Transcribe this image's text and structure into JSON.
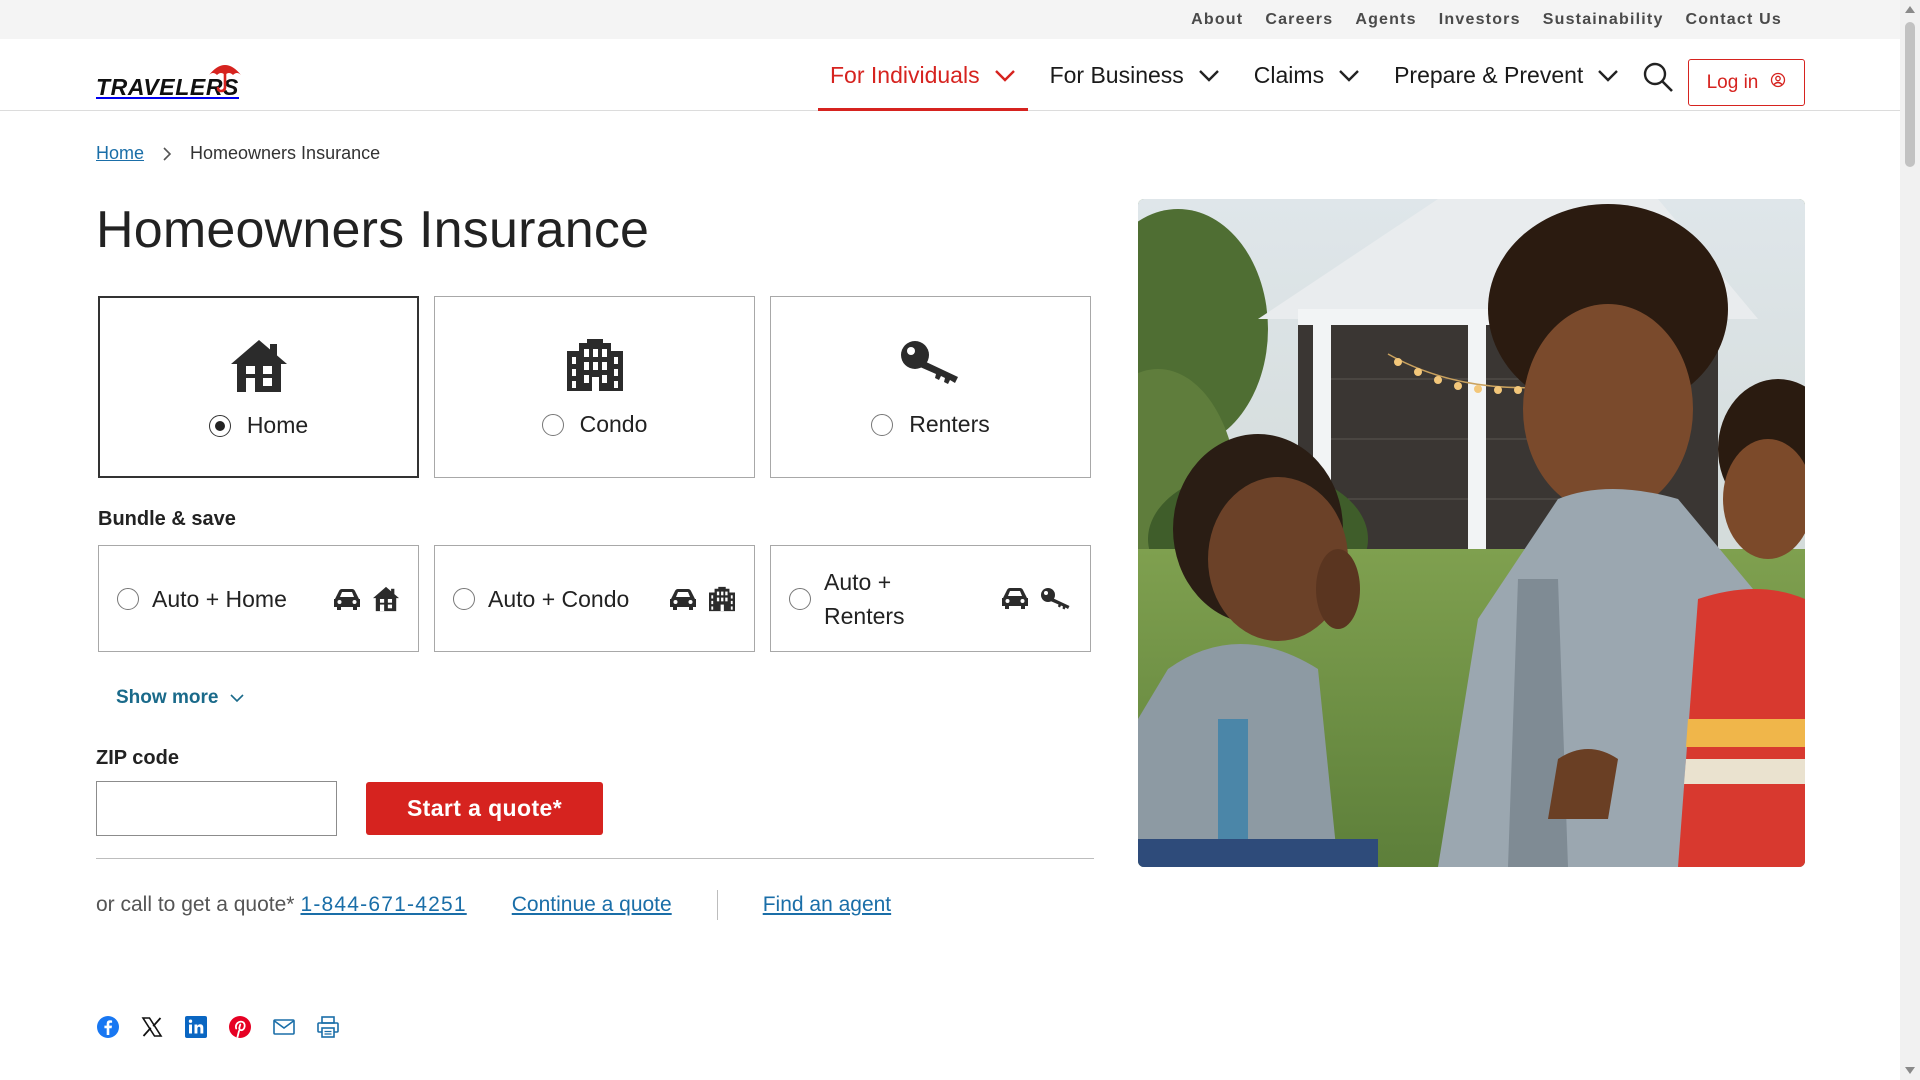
{
  "utility_nav": [
    "About",
    "Careers",
    "Agents",
    "Investors",
    "Sustainability",
    "Contact Us"
  ],
  "brand": {
    "name": "TRAVELERS",
    "color": "#d6231f"
  },
  "main_nav": {
    "items": [
      {
        "label": "For Individuals",
        "active": true
      },
      {
        "label": "For Business",
        "active": false
      },
      {
        "label": "Claims",
        "active": false
      },
      {
        "label": "Prepare & Prevent",
        "active": false
      }
    ],
    "search_icon": "search-icon",
    "login_label": "Log in"
  },
  "breadcrumb": {
    "home": "Home",
    "current": "Homeowners Insurance"
  },
  "page_title": "Homeowners Insurance",
  "products": [
    {
      "label": "Home",
      "icon": "house-icon",
      "selected": true
    },
    {
      "label": "Condo",
      "icon": "building-icon",
      "selected": false
    },
    {
      "label": "Renters",
      "icon": "key-icon",
      "selected": false
    }
  ],
  "bundle": {
    "heading": "Bundle & save",
    "options": [
      {
        "label": "Auto + Home",
        "icons": [
          "car-icon",
          "house-icon"
        ]
      },
      {
        "label": "Auto + Condo",
        "icons": [
          "car-icon",
          "building-icon"
        ]
      },
      {
        "label_line1": "Auto +",
        "label_line2": "Renters",
        "icons": [
          "car-icon",
          "key-icon"
        ]
      }
    ]
  },
  "show_more": "Show more",
  "zip": {
    "label": "ZIP code",
    "value": "",
    "placeholder": ""
  },
  "quote_button": "Start a quote*",
  "call": {
    "prefix": "or call to get a quote*",
    "phone": "1-844-671-4251",
    "continue": "Continue a quote",
    "find_agent": "Find an agent"
  },
  "share_icons": [
    "facebook-icon",
    "x-icon",
    "linkedin-icon",
    "pinterest-icon",
    "email-icon",
    "print-icon"
  ],
  "hero_image": "photo of mother and two children laughing on lawn in front of house"
}
